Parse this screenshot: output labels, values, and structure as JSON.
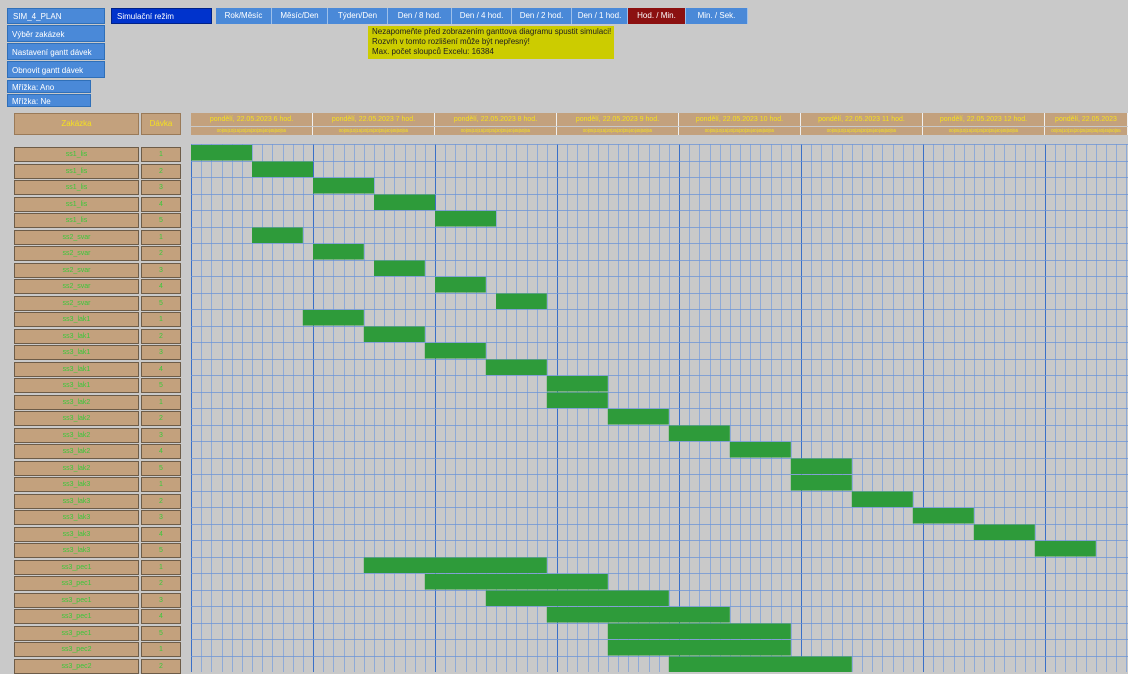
{
  "sidebar": {
    "title": "SIM_4_PLAN",
    "mode": "Simulační režim",
    "buttons": [
      "Výběr zakázek",
      "Nastavení gantt dávek",
      "Obnovit gantt dávek",
      "Mřížka: Ano",
      "Mřížka: Ne"
    ]
  },
  "zoom": {
    "buttons": [
      "Rok/Měsíc",
      "Měsíc/Den",
      "Týden/Den",
      "Den / 8 hod.",
      "Den / 4 hod.",
      "Den / 2 hod.",
      "Den / 1 hod.",
      "Hod. / Min.",
      "Min. / Sek."
    ],
    "active": "Hod. / Min."
  },
  "warning": {
    "lines": [
      "Nezapomeňte před zobrazením ganttova diagramu spustit simulaci!",
      "Rozvrh v tomto rozlišení může být nepřesný!",
      "Max. počet sloupců Excelu: 16384"
    ]
  },
  "table": {
    "header_order": "Zakázka",
    "header_batch": "Dávka",
    "hours": [
      "pondělí, 22.05.2023  6 hod.",
      "pondělí, 22.05.2023  7 hod.",
      "pondělí, 22.05.2023  8 hod.",
      "pondělí, 22.05.2023  9 hod.",
      "pondělí, 22.05.2023  10 hod.",
      "pondělí, 22.05.2023  11 hod.",
      "pondělí, 22.05.2023  12 hod.",
      "pondělí, 22.05.2023"
    ],
    "minutes": "00|05|10|15|20|25|30|35|40|45|50|55",
    "rows": [
      {
        "order": "ss1_lis",
        "batch": "1"
      },
      {
        "order": "ss1_lis",
        "batch": "2"
      },
      {
        "order": "ss1_lis",
        "batch": "3"
      },
      {
        "order": "ss1_lis",
        "batch": "4"
      },
      {
        "order": "ss1_lis",
        "batch": "5"
      },
      {
        "order": "ss2_svar",
        "batch": "1"
      },
      {
        "order": "ss2_svar",
        "batch": "2"
      },
      {
        "order": "ss2_svar",
        "batch": "3"
      },
      {
        "order": "ss2_svar",
        "batch": "4"
      },
      {
        "order": "ss2_svar",
        "batch": "5"
      },
      {
        "order": "ss3_lak1",
        "batch": "1"
      },
      {
        "order": "ss3_lak1",
        "batch": "2"
      },
      {
        "order": "ss3_lak1",
        "batch": "3"
      },
      {
        "order": "ss3_lak1",
        "batch": "4"
      },
      {
        "order": "ss3_lak1",
        "batch": "5"
      },
      {
        "order": "ss3_lak2",
        "batch": "1"
      },
      {
        "order": "ss3_lak2",
        "batch": "2"
      },
      {
        "order": "ss3_lak2",
        "batch": "3"
      },
      {
        "order": "ss3_lak2",
        "batch": "4"
      },
      {
        "order": "ss3_lak2",
        "batch": "5"
      },
      {
        "order": "ss3_lak3",
        "batch": "1"
      },
      {
        "order": "ss3_lak3",
        "batch": "2"
      },
      {
        "order": "ss3_lak3",
        "batch": "3"
      },
      {
        "order": "ss3_lak3",
        "batch": "4"
      },
      {
        "order": "ss3_lak3",
        "batch": "5"
      },
      {
        "order": "ss3_pec1",
        "batch": "1"
      },
      {
        "order": "ss3_pec1",
        "batch": "2"
      },
      {
        "order": "ss3_pec1",
        "batch": "3"
      },
      {
        "order": "ss3_pec1",
        "batch": "4"
      },
      {
        "order": "ss3_pec1",
        "batch": "5"
      },
      {
        "order": "ss3_pec2",
        "batch": "1"
      },
      {
        "order": "ss3_pec2",
        "batch": "2"
      }
    ]
  },
  "gantt": {
    "start_time": "06:00",
    "bar_color": "#2e9b3a",
    "bars": [
      {
        "start": "06:00",
        "end": "06:30"
      },
      {
        "start": "06:30",
        "end": "07:00"
      },
      {
        "start": "07:00",
        "end": "07:30"
      },
      {
        "start": "07:30",
        "end": "08:00"
      },
      {
        "start": "08:00",
        "end": "08:30"
      },
      {
        "start": "06:30",
        "end": "06:55"
      },
      {
        "start": "07:00",
        "end": "07:25"
      },
      {
        "start": "07:30",
        "end": "07:55"
      },
      {
        "start": "08:00",
        "end": "08:25"
      },
      {
        "start": "08:30",
        "end": "08:55"
      },
      {
        "start": "06:55",
        "end": "07:25"
      },
      {
        "start": "07:25",
        "end": "07:55"
      },
      {
        "start": "07:55",
        "end": "08:25"
      },
      {
        "start": "08:25",
        "end": "08:55"
      },
      {
        "start": "08:55",
        "end": "09:25"
      },
      {
        "start": "08:55",
        "end": "09:25"
      },
      {
        "start": "09:25",
        "end": "09:55"
      },
      {
        "start": "09:55",
        "end": "10:25"
      },
      {
        "start": "10:25",
        "end": "10:55"
      },
      {
        "start": "10:55",
        "end": "11:25"
      },
      {
        "start": "10:55",
        "end": "11:25"
      },
      {
        "start": "11:25",
        "end": "11:55"
      },
      {
        "start": "11:55",
        "end": "12:25"
      },
      {
        "start": "12:25",
        "end": "12:55"
      },
      {
        "start": "12:55",
        "end": "13:25"
      },
      {
        "start": "07:25",
        "end": "08:55"
      },
      {
        "start": "07:55",
        "end": "09:25"
      },
      {
        "start": "08:25",
        "end": "09:55"
      },
      {
        "start": "08:55",
        "end": "10:25"
      },
      {
        "start": "09:25",
        "end": "10:55"
      },
      {
        "start": "09:25",
        "end": "10:55"
      },
      {
        "start": "09:55",
        "end": "11:25"
      }
    ]
  }
}
